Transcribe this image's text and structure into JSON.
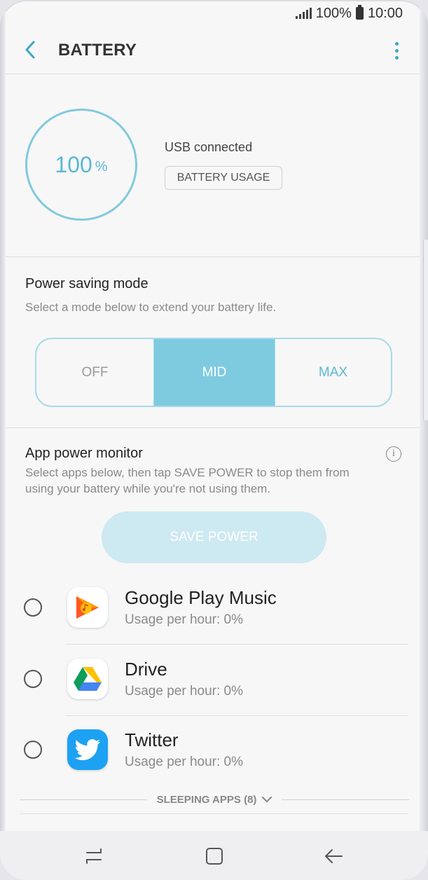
{
  "status_bar": {
    "battery_pct": "100%",
    "time": "10:00"
  },
  "header": {
    "title": "BATTERY",
    "back_icon": "back-arrow-icon",
    "more_icon": "more-vert-icon"
  },
  "battery": {
    "percent": "100",
    "unit": "%",
    "status": "USB connected",
    "usage_button": "BATTERY USAGE"
  },
  "power_saving": {
    "title": "Power saving mode",
    "subtitle": "Select a mode below to extend your battery life.",
    "modes": [
      "OFF",
      "MID",
      "MAX"
    ],
    "selected": "MID"
  },
  "app_monitor": {
    "title": "App power monitor",
    "subtitle_line1": "Select apps below, then tap SAVE POWER to stop them from",
    "subtitle_line2": "using your battery while you're not using them.",
    "save_button": "SAVE POWER",
    "apps": [
      {
        "name": "Google Play Music",
        "usage": "Usage per hour: 0%",
        "icon": "google-play-music-icon"
      },
      {
        "name": "Drive",
        "usage": "Usage per hour: 0%",
        "icon": "google-drive-icon"
      },
      {
        "name": "Twitter",
        "usage": "Usage per hour: 0%",
        "icon": "twitter-icon"
      }
    ],
    "sleeping_label": "SLEEPING APPS (8)"
  },
  "colors": {
    "accent": "#5ab8d3",
    "mode_selected_bg": "#7ecbe0",
    "save_button_bg": "#cde9f1"
  }
}
